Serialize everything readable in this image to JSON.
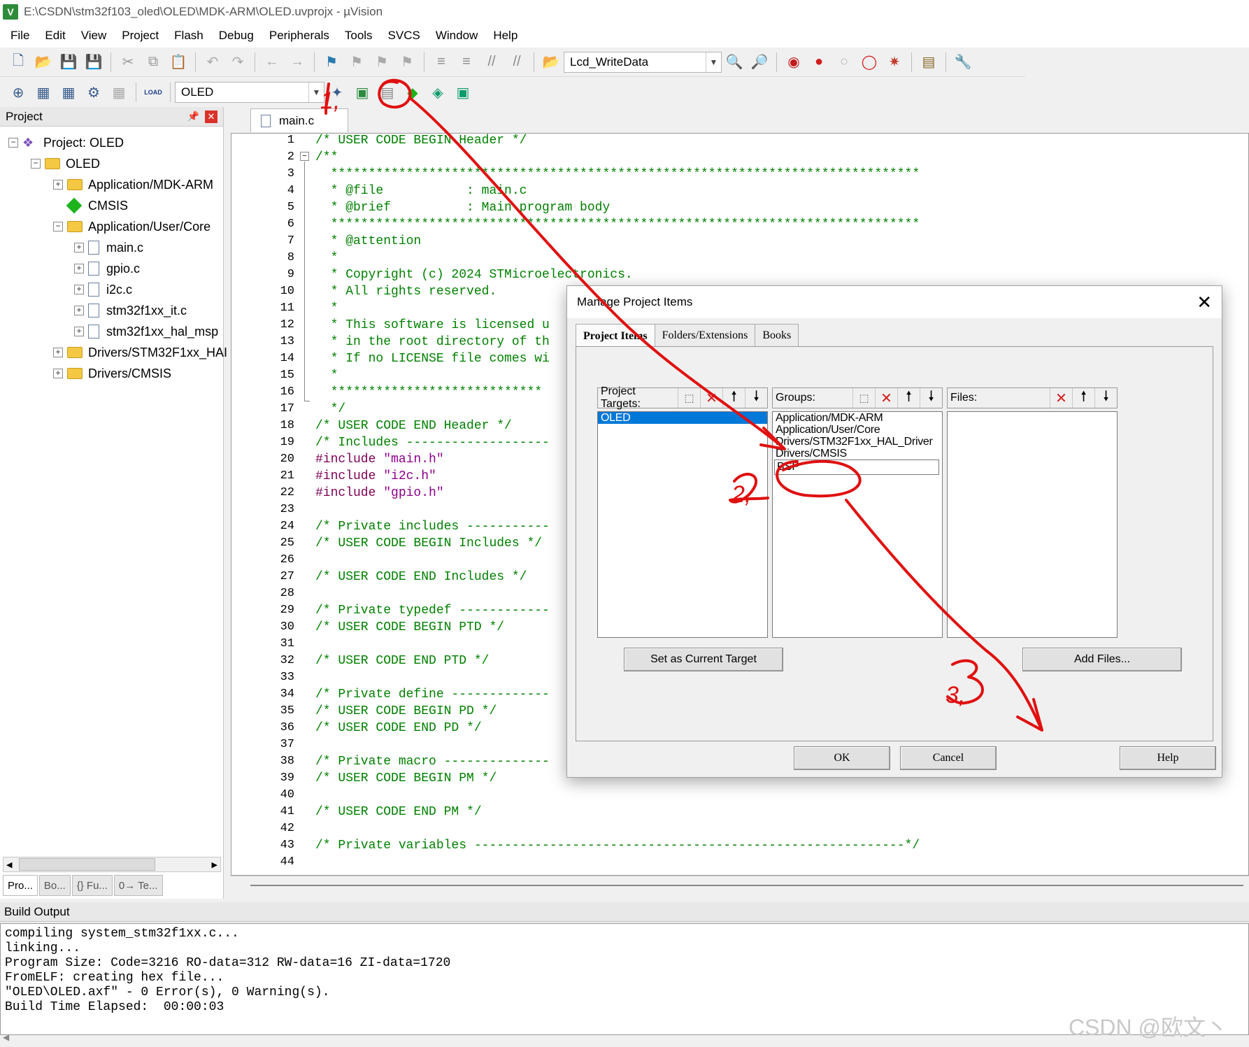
{
  "window": {
    "title": "E:\\CSDN\\stm32f103_oled\\OLED\\MDK-ARM\\OLED.uvprojx - µVision",
    "app_icon": "V"
  },
  "menu": [
    "File",
    "Edit",
    "View",
    "Project",
    "Flash",
    "Debug",
    "Peripherals",
    "Tools",
    "SVCS",
    "Window",
    "Help"
  ],
  "toolbar1": {
    "function_combo": "Lcd_WriteData"
  },
  "toolbar2": {
    "target_combo": "OLED",
    "load_label": "LOAD"
  },
  "project_panel": {
    "header": "Project",
    "tree": [
      {
        "label": "Project: OLED",
        "icon": "project-icon"
      },
      {
        "label": "OLED",
        "icon": "target-icon"
      },
      {
        "label": "Application/MDK-ARM",
        "icon": "folder-icon"
      },
      {
        "label": "CMSIS",
        "icon": "gem-icon"
      },
      {
        "label": "Application/User/Core",
        "icon": "folder-open-icon"
      },
      {
        "label": "main.c",
        "icon": "file-icon"
      },
      {
        "label": "gpio.c",
        "icon": "file-icon"
      },
      {
        "label": "i2c.c",
        "icon": "file-icon"
      },
      {
        "label": "stm32f1xx_it.c",
        "icon": "file-icon"
      },
      {
        "label": "stm32f1xx_hal_msp",
        "icon": "file-icon"
      },
      {
        "label": "Drivers/STM32F1xx_HAI",
        "icon": "folder-icon"
      },
      {
        "label": "Drivers/CMSIS",
        "icon": "folder-icon"
      }
    ],
    "tabs": [
      "Pro...",
      "Bo...",
      "{} Fu...",
      "0→ Te..."
    ]
  },
  "editor": {
    "tab": "main.c",
    "lines": [
      [
        {
          "t": "/* USER CODE BEGIN Header */",
          "c": "c-cmt"
        }
      ],
      [
        {
          "t": "/**",
          "c": "c-cmt"
        }
      ],
      [
        {
          "t": "  ******************************************************************************",
          "c": "c-cmt"
        }
      ],
      [
        {
          "t": "  * @file           : main.c",
          "c": "c-cmt"
        }
      ],
      [
        {
          "t": "  * @brief          : Main program body",
          "c": "c-cmt"
        }
      ],
      [
        {
          "t": "  ******************************************************************************",
          "c": "c-cmt"
        }
      ],
      [
        {
          "t": "  * @attention",
          "c": "c-cmt"
        }
      ],
      [
        {
          "t": "  *",
          "c": "c-cmt"
        }
      ],
      [
        {
          "t": "  * Copyright (c) 2024 STMicroelectronics.",
          "c": "c-cmt"
        }
      ],
      [
        {
          "t": "  * All rights reserved.",
          "c": "c-cmt"
        }
      ],
      [
        {
          "t": "  *",
          "c": "c-cmt"
        }
      ],
      [
        {
          "t": "  * This software is licensed u",
          "c": "c-cmt"
        }
      ],
      [
        {
          "t": "  * in the root directory of th",
          "c": "c-cmt"
        }
      ],
      [
        {
          "t": "  * If no LICENSE file comes wi",
          "c": "c-cmt"
        }
      ],
      [
        {
          "t": "  *",
          "c": "c-cmt"
        }
      ],
      [
        {
          "t": "  ****************************",
          "c": "c-cmt"
        }
      ],
      [
        {
          "t": "  */",
          "c": "c-cmt"
        }
      ],
      [
        {
          "t": "/* USER CODE END Header */",
          "c": "c-cmt"
        }
      ],
      [
        {
          "t": "/* Includes -------------------",
          "c": "c-cmt"
        }
      ],
      [
        {
          "t": "#include ",
          "c": "c-pp"
        },
        {
          "t": "\"main.h\"",
          "c": "c-str"
        }
      ],
      [
        {
          "t": "#include ",
          "c": "c-pp"
        },
        {
          "t": "\"i2c.h\"",
          "c": "c-str"
        }
      ],
      [
        {
          "t": "#include ",
          "c": "c-pp"
        },
        {
          "t": "\"gpio.h\"",
          "c": "c-str"
        }
      ],
      [
        {
          "t": "",
          "c": "c-cmt"
        }
      ],
      [
        {
          "t": "/* Private includes -----------",
          "c": "c-cmt"
        }
      ],
      [
        {
          "t": "/* USER CODE BEGIN Includes */",
          "c": "c-cmt"
        }
      ],
      [
        {
          "t": "",
          "c": "c-cmt"
        }
      ],
      [
        {
          "t": "/* USER CODE END Includes */",
          "c": "c-cmt"
        }
      ],
      [
        {
          "t": "",
          "c": "c-cmt"
        }
      ],
      [
        {
          "t": "/* Private typedef ------------",
          "c": "c-cmt"
        }
      ],
      [
        {
          "t": "/* USER CODE BEGIN PTD */",
          "c": "c-cmt"
        }
      ],
      [
        {
          "t": "",
          "c": "c-cmt"
        }
      ],
      [
        {
          "t": "/* USER CODE END PTD */",
          "c": "c-cmt"
        }
      ],
      [
        {
          "t": "",
          "c": "c-cmt"
        }
      ],
      [
        {
          "t": "/* Private define -------------",
          "c": "c-cmt"
        }
      ],
      [
        {
          "t": "/* USER CODE BEGIN PD */",
          "c": "c-cmt"
        }
      ],
      [
        {
          "t": "/* USER CODE END PD */",
          "c": "c-cmt"
        }
      ],
      [
        {
          "t": "",
          "c": "c-cmt"
        }
      ],
      [
        {
          "t": "/* Private macro --------------",
          "c": "c-cmt"
        }
      ],
      [
        {
          "t": "/* USER CODE BEGIN PM */",
          "c": "c-cmt"
        }
      ],
      [
        {
          "t": "",
          "c": "c-cmt"
        }
      ],
      [
        {
          "t": "/* USER CODE END PM */",
          "c": "c-cmt"
        }
      ],
      [
        {
          "t": "",
          "c": "c-cmt"
        }
      ],
      [
        {
          "t": "/* Private variables ---------------------------------------------------------*/",
          "c": "c-cmt"
        }
      ],
      [
        {
          "t": "",
          "c": "c-cmt"
        }
      ]
    ]
  },
  "build_output": {
    "header": "Build Output",
    "lines": [
      "compiling system_stm32f1xx.c...",
      "linking...",
      "Program Size: Code=3216 RO-data=312 RW-data=16 ZI-data=1720",
      "FromELF: creating hex file...",
      "\"OLED\\OLED.axf\" - 0 Error(s), 0 Warning(s).",
      "Build Time Elapsed:  00:00:03"
    ]
  },
  "watermark": "CSDN @欧文丶",
  "dialog": {
    "title": "Manage Project Items",
    "tabs": [
      "Project Items",
      "Folders/Extensions",
      "Books"
    ],
    "targets": {
      "label": "Project Targets:",
      "items": [
        "OLED"
      ],
      "selected": "OLED"
    },
    "groups": {
      "label": "Groups:",
      "items": [
        "Application/MDK-ARM",
        "Application/User/Core",
        "Drivers/STM32F1xx_HAL_Driver",
        "Drivers/CMSIS"
      ],
      "editing_value": "BSP"
    },
    "files": {
      "label": "Files:"
    },
    "set_current_target": "Set as Current Target",
    "add_files": "Add Files...",
    "ok": "OK",
    "cancel": "Cancel",
    "help": "Help"
  },
  "annotations": [
    "1,",
    "2,",
    "3,"
  ],
  "colors": {
    "accent": "#0078d7",
    "annotation": "#e01010",
    "comment": "#008000"
  }
}
